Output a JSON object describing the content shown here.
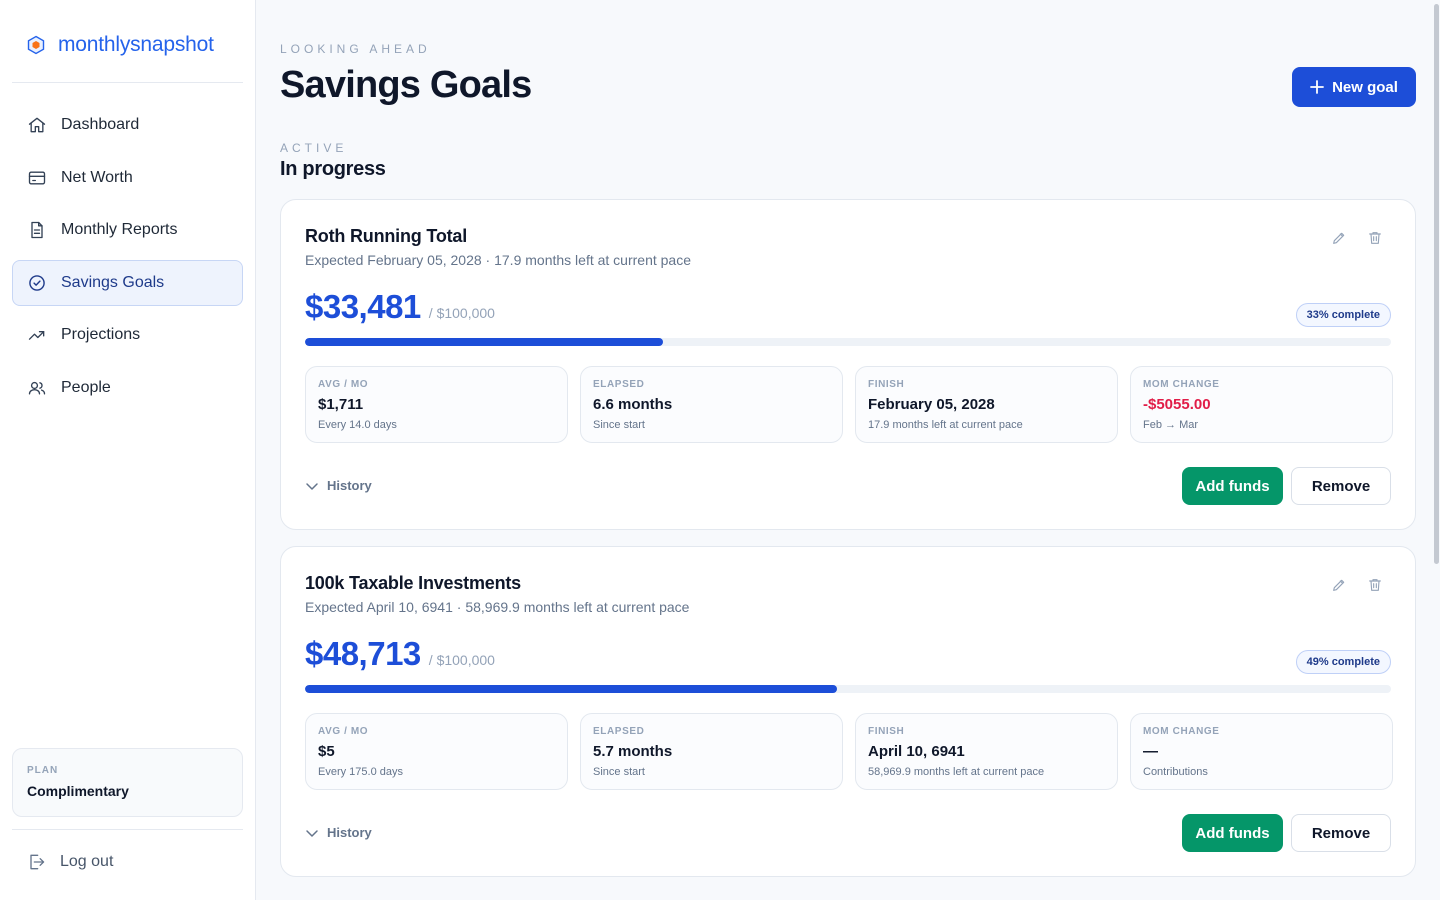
{
  "brand": {
    "name": "monthlysnapshot",
    "accent": "#2563eb"
  },
  "sidebar": {
    "items": [
      {
        "label": "Dashboard",
        "icon": "home-icon",
        "active": false
      },
      {
        "label": "Net Worth",
        "icon": "credit-card-icon",
        "active": false
      },
      {
        "label": "Monthly Reports",
        "icon": "document-icon",
        "active": false
      },
      {
        "label": "Savings Goals",
        "icon": "check-circle-icon",
        "active": true
      },
      {
        "label": "Projections",
        "icon": "trending-up-icon",
        "active": false
      },
      {
        "label": "People",
        "icon": "users-icon",
        "active": false
      }
    ],
    "plan": {
      "label": "PLAN",
      "value": "Complimentary"
    },
    "logout": "Log out"
  },
  "header": {
    "eyebrow": "LOOKING AHEAD",
    "title": "Savings Goals",
    "new_goal_label": "New goal"
  },
  "section": {
    "eyebrow": "ACTIVE",
    "title": "In progress"
  },
  "goals": [
    {
      "name": "Roth Running Total",
      "subtitle": "Expected February 05, 2028 · 17.9 months left at current pace",
      "amount": "$33,481",
      "target": "/ $100,000",
      "percent_label": "33% complete",
      "progress": 0.33,
      "stats": [
        {
          "label": "AVG / MO",
          "value": "$1,711",
          "note": "Every 14.0 days"
        },
        {
          "label": "ELAPSED",
          "value": "6.6 months",
          "note": "Since start"
        },
        {
          "label": "FINISH",
          "value": "February 05, 2028",
          "note": "17.9 months left at current pace"
        },
        {
          "label": "MOM CHANGE",
          "value": "-$5055.00",
          "note": "Feb → Mar",
          "negative": true
        }
      ],
      "history_label": "History",
      "add_label": "Add funds",
      "remove_label": "Remove"
    },
    {
      "name": "100k Taxable Investments",
      "subtitle": "Expected April 10, 6941 · 58,969.9 months left at current pace",
      "amount": "$48,713",
      "target": "/ $100,000",
      "percent_label": "49% complete",
      "progress": 0.49,
      "stats": [
        {
          "label": "AVG / MO",
          "value": "$5",
          "note": "Every 175.0 days"
        },
        {
          "label": "ELAPSED",
          "value": "5.7 months",
          "note": "Since start"
        },
        {
          "label": "FINISH",
          "value": "April 10, 6941",
          "note": "58,969.9 months left at current pace"
        },
        {
          "label": "MOM CHANGE",
          "value": "—",
          "note": "Contributions"
        }
      ],
      "history_label": "History",
      "add_label": "Add funds",
      "remove_label": "Remove"
    }
  ],
  "colors": {
    "primary": "#1d4ed8",
    "success": "#059669",
    "negative": "#e11d48"
  }
}
